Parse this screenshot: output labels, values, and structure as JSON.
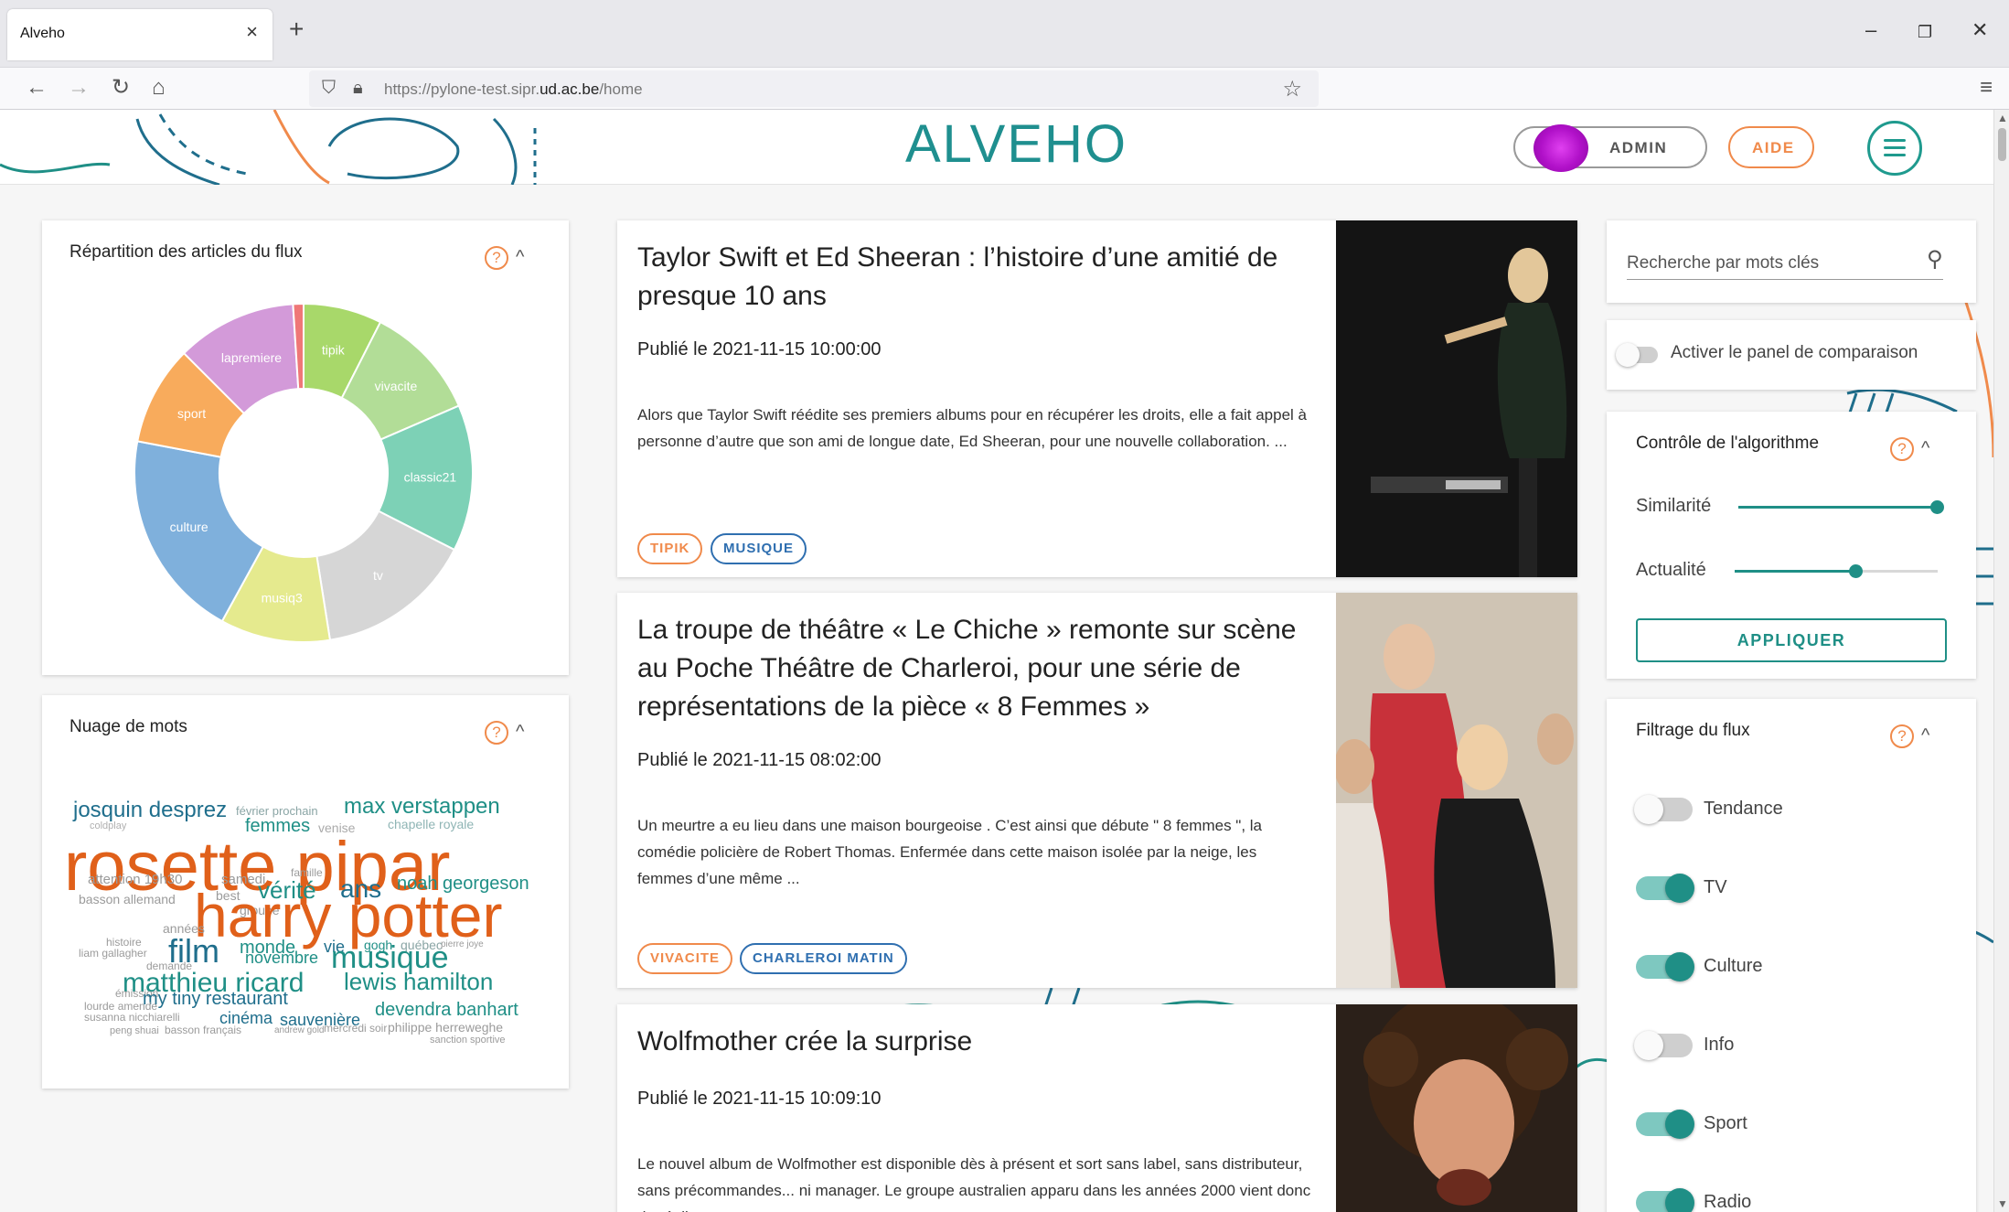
{
  "browser": {
    "tab_title": "Alveho",
    "url_prefix": "https://pylone-test.sipr.",
    "url_domain": "ud.ac.be",
    "url_path": "/home"
  },
  "header": {
    "logo": "ALVEHO",
    "admin_label": "ADMIN",
    "aide_label": "AIDE"
  },
  "left": {
    "repartition_title": "Répartition des articles du flux",
    "donut_slices": [
      {
        "label": "tipik",
        "value": 7.5,
        "color": "#a8d86a"
      },
      {
        "label": "vivacite",
        "value": 11,
        "color": "#b2dd97"
      },
      {
        "label": "classic21",
        "value": 14,
        "color": "#7dd1b6"
      },
      {
        "label": "tv",
        "value": 15,
        "color": "#d6d6d6"
      },
      {
        "label": "musiq3",
        "value": 10.5,
        "color": "#e5ea8e"
      },
      {
        "label": "culture",
        "value": 20,
        "color": "#7fb0dc"
      },
      {
        "label": "sport",
        "value": 9.5,
        "color": "#f8ab5c"
      },
      {
        "label": "lapremiere",
        "value": 11.5,
        "color": "#d39ad9"
      },
      {
        "label": "",
        "value": 1,
        "color": "#ef7777"
      }
    ],
    "wordcloud_title": "Nuage de mots",
    "words": [
      {
        "text": "josquin desprez",
        "color": "#1f6e8c"
      },
      {
        "text": "février prochain",
        "color": "#8aa5a5"
      },
      {
        "text": "max verstappen",
        "color": "#1f8f86"
      },
      {
        "text": "coldplay",
        "color": "#b0b0b0"
      },
      {
        "text": "femmes",
        "color": "#1f8f86"
      },
      {
        "text": "venise",
        "color": "#aaaaaa"
      },
      {
        "text": "chapelle royale",
        "color": "#8fb5b5"
      },
      {
        "text": "rosette pipar",
        "color": "#e0601a"
      },
      {
        "text": "attention 19h30",
        "color": "#9b9b9b"
      },
      {
        "text": "samedi",
        "color": "#9b9b9b"
      },
      {
        "text": "famille",
        "color": "#9b9b9b"
      },
      {
        "text": "vérité",
        "color": "#1f8f86"
      },
      {
        "text": "ans",
        "color": "#1f6e8c"
      },
      {
        "text": "noah georgeson",
        "color": "#1f8f86"
      },
      {
        "text": "basson allemand",
        "color": "#9b9b9b"
      },
      {
        "text": "best",
        "color": "#9b9b9b"
      },
      {
        "text": "groupe",
        "color": "#9b9b9b"
      },
      {
        "text": "harry potter",
        "color": "#e0601a"
      },
      {
        "text": "années",
        "color": "#9b9b9b"
      },
      {
        "text": "histoire",
        "color": "#9b9b9b"
      },
      {
        "text": "liam gallagher",
        "color": "#9b9b9b"
      },
      {
        "text": "film",
        "color": "#1f6e8c"
      },
      {
        "text": "monde",
        "color": "#1f8f86"
      },
      {
        "text": "vie",
        "color": "#1f6e8c"
      },
      {
        "text": "gogh",
        "color": "#1f8f86"
      },
      {
        "text": "québec",
        "color": "#8aa5a5"
      },
      {
        "text": "pierre joye",
        "color": "#9b9b9b"
      },
      {
        "text": "novembre",
        "color": "#1f8f86"
      },
      {
        "text": "musique",
        "color": "#1f8f86"
      },
      {
        "text": "demande",
        "color": "#9b9b9b"
      },
      {
        "text": "matthieu ricard",
        "color": "#1f8f86"
      },
      {
        "text": "lewis hamilton",
        "color": "#1f8f86"
      },
      {
        "text": "émission",
        "color": "#9b9b9b"
      },
      {
        "text": "my tiny restaurant",
        "color": "#1f6e8c"
      },
      {
        "text": "lourde amende",
        "color": "#9b9b9b"
      },
      {
        "text": "devendra banhart",
        "color": "#1f8f86"
      },
      {
        "text": "susanna nicchiarelli",
        "color": "#9b9b9b"
      },
      {
        "text": "cinéma",
        "color": "#1f6e8c"
      },
      {
        "text": "sauvenière",
        "color": "#1f6e8c"
      },
      {
        "text": "peng shuai",
        "color": "#9b9b9b"
      },
      {
        "text": "basson français",
        "color": "#9b9b9b"
      },
      {
        "text": "andrew gold",
        "color": "#9b9b9b"
      },
      {
        "text": "mercredi soir",
        "color": "#9b9b9b"
      },
      {
        "text": "philippe herreweghe",
        "color": "#9b9b9b"
      },
      {
        "text": "sanction sportive",
        "color": "#9b9b9b"
      }
    ]
  },
  "articles": [
    {
      "title": "Taylor Swift et Ed Sheeran : l’histoire d’une amitié de presque 10 ans",
      "date": "Publié le 2021-11-15 10:00:00",
      "text": "Alors que Taylor Swift réédite ses premiers albums pour en récupérer les droits, elle a fait appel à personne d’autre que son ami de longue date, Ed Sheeran, pour une nouvelle collaboration. ...",
      "tags": [
        "TIPIK",
        "MUSIQUE"
      ]
    },
    {
      "title": "La troupe de théâtre « Le Chiche » remonte sur scène au Poche Théâtre de Charleroi, pour une série de représentations de la pièce « 8 Femmes »",
      "date": "Publié le 2021-11-15 08:02:00",
      "text": "Un meurtre a eu lieu dans une maison bourgeoise . C’est ainsi que débute \" 8 femmes \", la comédie policière de Robert Thomas.   Enfermée dans cette maison isolée par la neige, les femmes d’une même ...",
      "tags": [
        "VIVACITE",
        "CHARLEROI MATIN"
      ]
    },
    {
      "title": "Wolfmother crée la surprise",
      "date": "Publié le 2021-11-15 10:09:10",
      "text": "Le nouvel album de Wolfmother est disponible dès à présent et sort sans label, sans distributeur, sans précommandes... ni manager. Le groupe australien apparu dans les années 2000 vient donc de réalise"
    }
  ],
  "right": {
    "search_placeholder": "Recherche par mots clés",
    "comparison_label": "Activer le panel de comparaison",
    "algo_title": "Contrôle de l'algorithme",
    "similarite_label": "Similarité",
    "similarite_value": 1.0,
    "actualite_label": "Actualité",
    "actualite_value": 0.6,
    "apply_label": "APPLIQUER",
    "filter_title": "Filtrage du flux",
    "filters": [
      {
        "label": "Tendance",
        "on": false
      },
      {
        "label": "TV",
        "on": true
      },
      {
        "label": "Culture",
        "on": true
      },
      {
        "label": "Info",
        "on": false
      },
      {
        "label": "Sport",
        "on": true
      },
      {
        "label": "Radio",
        "on": true
      }
    ]
  },
  "colors": {
    "teal": "#1f8f86",
    "orange": "#f08a4b",
    "blue": "#2f6fb0"
  }
}
